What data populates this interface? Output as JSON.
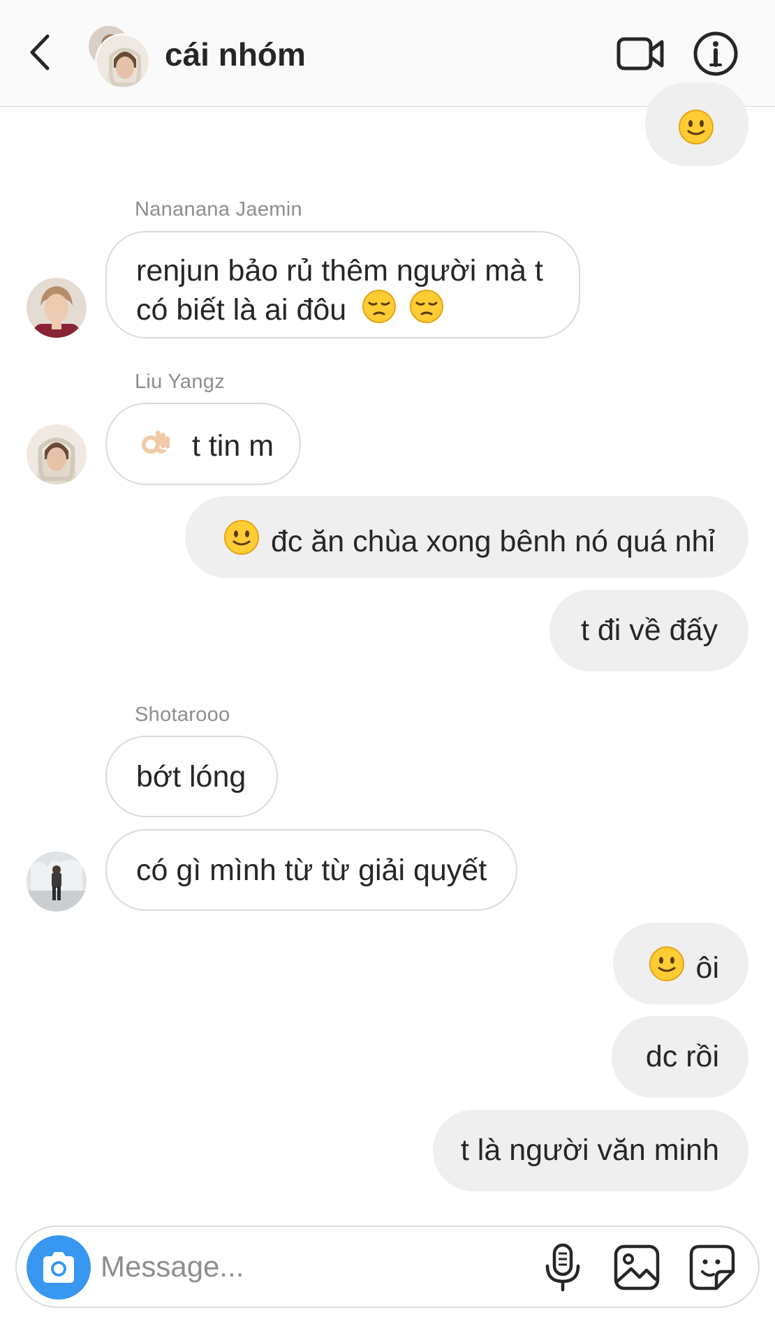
{
  "header": {
    "title": "cái nhóm"
  },
  "messages": {
    "m0_emoji": "smile-emoji",
    "m1_sender": "Nananana Jaemin",
    "m1_line1": "renjun bảo rủ thêm người mà t",
    "m1_line2": "có biết là ai đôu",
    "m2_sender": "Liu Yangz",
    "m2_text": "t tin m",
    "m3_text": "đc ăn chùa xong bênh nó quá nhỉ",
    "m4_text": "t đi về đấy",
    "m5_sender": "Shotarooo",
    "m5_text": "bớt lóng",
    "m6_text": "có gì mình từ từ giải quyết",
    "m7_text": "ôi",
    "m8_text": "dc rồi",
    "m9_text": "t là người văn minh"
  },
  "composer": {
    "placeholder": "Message..."
  },
  "colors": {
    "accent": "#3897f0",
    "outgoing_bubble": "#efefef",
    "incoming_border": "#dbdbdb",
    "text": "#262626",
    "muted": "#8e8e8e"
  }
}
